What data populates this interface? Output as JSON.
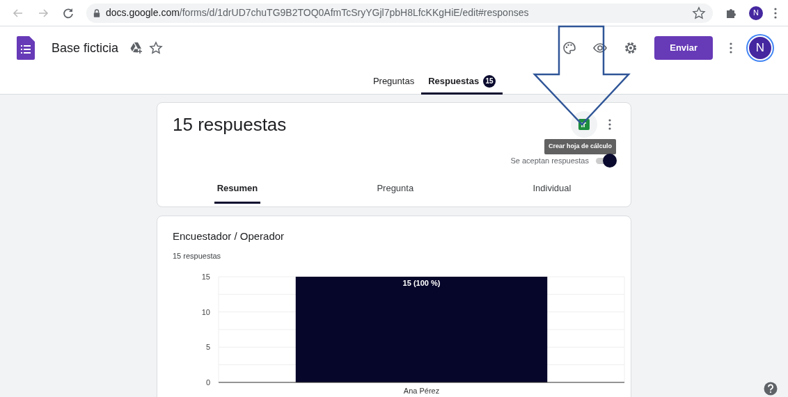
{
  "browser": {
    "url_host": "docs.google.com",
    "url_path": "/forms/d/1drUD7chuTG9B2TOQ0AfmTcSryYGjl7pbH8LfcKKgHiE/edit#responses",
    "profile_initial": "N"
  },
  "header": {
    "title": "Base ficticia",
    "send_button": "Enviar",
    "avatar_initial": "N"
  },
  "tabs": [
    {
      "label": "Preguntas",
      "selected": false
    },
    {
      "label": "Respuestas",
      "selected": true,
      "count": "15"
    }
  ],
  "summary_card": {
    "title": "15 respuestas",
    "tooltip": "Crear hoja de cálculo",
    "accepting_label": "Se aceptan respuestas",
    "accepting": true,
    "subtabs": [
      {
        "label": "Resumen",
        "selected": true
      },
      {
        "label": "Pregunta",
        "selected": false
      },
      {
        "label": "Individual",
        "selected": false
      }
    ]
  },
  "question_card": {
    "title": "Encuestador / Operador",
    "subtitle": "15 respuestas",
    "chart_data": {
      "type": "bar",
      "categories": [
        "Ana Pérez"
      ],
      "values": [
        15
      ],
      "ylim": [
        0,
        15
      ],
      "yticks": [
        0,
        5,
        10,
        15
      ],
      "value_labels": [
        "15 (100 %)"
      ]
    }
  }
}
